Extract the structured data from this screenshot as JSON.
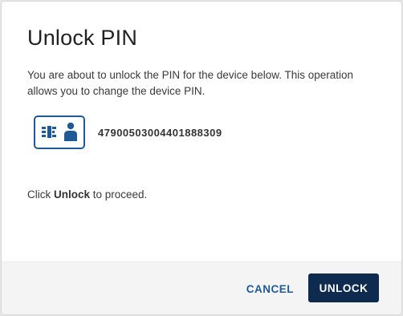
{
  "dialog": {
    "title": "Unlock PIN",
    "description": "You are about to unlock the PIN for the device below. This operation allows you to change the device PIN.",
    "device": {
      "icon": "smart-card-user-icon",
      "id": "47900503004401888309"
    },
    "instruction": {
      "prefix": "Click ",
      "emphasis": "Unlock",
      "suffix": " to proceed."
    },
    "buttons": {
      "cancel_label": "CANCEL",
      "unlock_label": "UNLOCK"
    }
  },
  "colors": {
    "accent": "#1f5a96",
    "primary_button": "#0f2a4f",
    "footer_bg": "#f4f4f4"
  }
}
